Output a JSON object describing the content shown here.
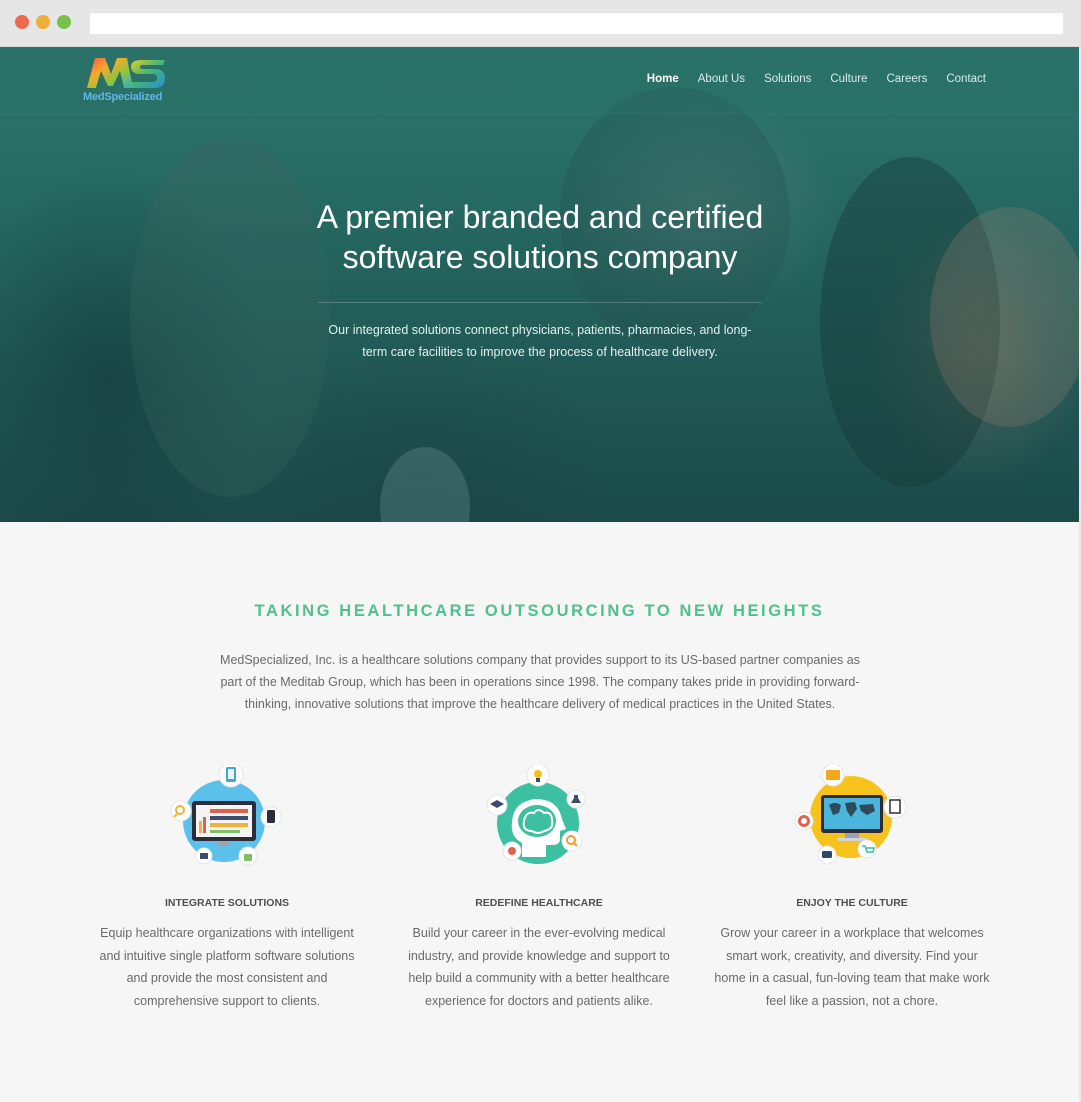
{
  "browser": {
    "url": ""
  },
  "brand": {
    "name": "MedSpecialized",
    "monogram": "MS"
  },
  "nav": {
    "items": [
      {
        "label": "Home",
        "active": true
      },
      {
        "label": "About Us"
      },
      {
        "label": "Solutions"
      },
      {
        "label": "Culture"
      },
      {
        "label": "Careers"
      },
      {
        "label": "Contact"
      }
    ]
  },
  "hero": {
    "title_line1": "A premier branded and certified",
    "title_line2": "software solutions company",
    "subtitle_line1": "Our integrated solutions connect physicians, patients, pharmacies, and long-",
    "subtitle_line2": "term care facilities to improve the process of healthcare delivery."
  },
  "about": {
    "heading": "TAKING HEALTHCARE OUTSOURCING TO NEW HEIGHTS",
    "line1": "MedSpecialized, Inc. is a healthcare solutions company that provides support to its US-based partner companies as",
    "line2": "part of the Meditab Group, which has been in operations since 1998. The company takes pride in providing forward-",
    "line3": "thinking, innovative solutions that improve the healthcare delivery of medical practices in the United States."
  },
  "features": [
    {
      "title": "INTEGRATE SOLUTIONS",
      "icon": "monitor-dashboard-icon",
      "lines": [
        "Equip healthcare organizations with intelligent",
        "and intuitive single platform software solutions",
        "and provide the most consistent and",
        "comprehensive support to clients."
      ]
    },
    {
      "title": "REDEFINE HEALTHCARE",
      "icon": "brain-head-icon",
      "lines": [
        "Build your career in the ever-evolving medical",
        "industry, and provide knowledge and support to",
        "help build a community with a better healthcare",
        "experience for doctors and patients alike."
      ]
    },
    {
      "title": "ENJOY THE CULTURE",
      "icon": "world-map-monitor-icon",
      "lines": [
        "Grow your career in a workplace that welcomes",
        "smart work, creativity, and diversity. Find your",
        "home in a casual, fun-loving team that make work",
        "feel like a passion, not a chore."
      ]
    }
  ],
  "colors": {
    "accent_green": "#4fc08e",
    "hero_teal": "#2a746d",
    "icon_blue": "#5cc1ea",
    "icon_teal": "#3dbfa2",
    "icon_yellow": "#f7c21b"
  }
}
